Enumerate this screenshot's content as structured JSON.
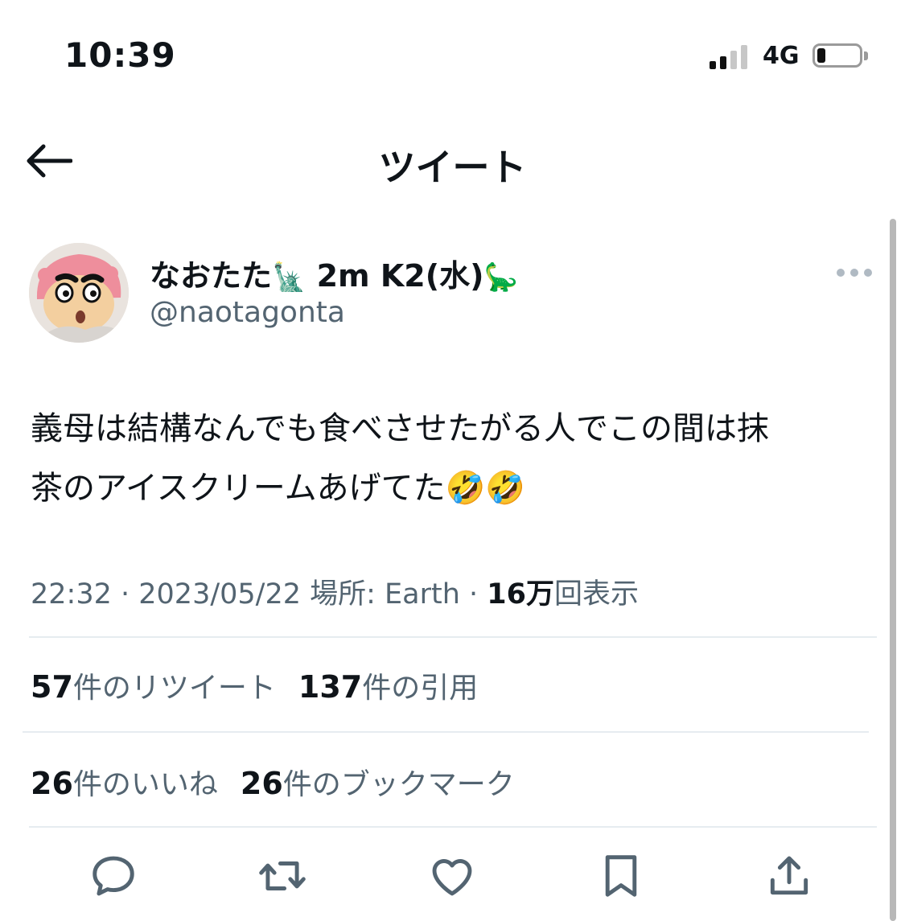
{
  "status_bar": {
    "time": "10:39",
    "network": "4G",
    "signal_bars_active": 2,
    "signal_bars_total": 4,
    "battery_level": 0.15
  },
  "header": {
    "title": "ツイート",
    "back_icon": "arrow-left-icon"
  },
  "tweet": {
    "author": {
      "display_name_part1": "なおたた",
      "emoji1": "🗽",
      "display_name_part2": " 2m K2(水)",
      "emoji2": "🦕",
      "username": "@naotagonta"
    },
    "text_line1": "義母は結構なんでも食べさせたがる人でこの間は抹",
    "text_line2": "茶のアイスクリームあげてた🤣🤣",
    "time": "22:32",
    "separator": " · ",
    "date": "2023/05/22",
    "location_label": " 場所: Earth",
    "views_count": "16万",
    "views_label": "回表示",
    "retweets_count": "57",
    "retweets_label": "件のリツイート",
    "quotes_count": "137",
    "quotes_label": "件の引用",
    "likes_count": "26",
    "likes_label": "件のいいね",
    "bookmarks_count": "26",
    "bookmarks_label": "件のブックマーク"
  },
  "actions": [
    {
      "name": "reply",
      "icon": "speech-bubble-icon"
    },
    {
      "name": "retweet",
      "icon": "retweet-arrows-icon"
    },
    {
      "name": "like",
      "icon": "heart-icon"
    },
    {
      "name": "bookmark",
      "icon": "bookmark-icon"
    },
    {
      "name": "share",
      "icon": "share-upload-icon"
    }
  ],
  "colors": {
    "text_primary": "#0f1419",
    "text_secondary": "#536471",
    "divider": "#e6ecf0",
    "icon": "#536471"
  }
}
